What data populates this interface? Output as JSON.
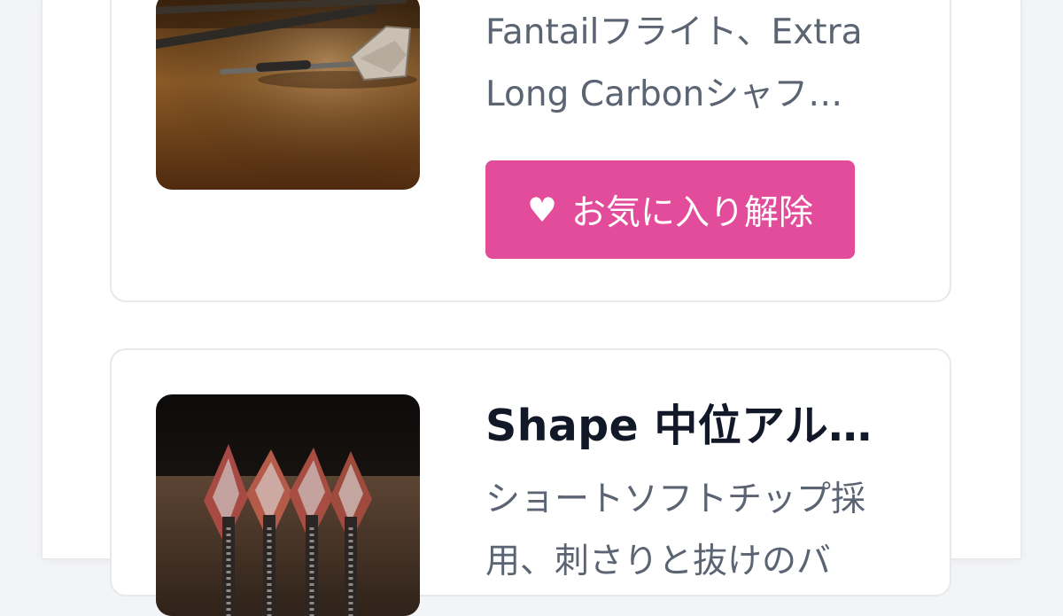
{
  "favorites": {
    "items": [
      {
        "title": "",
        "description": "Fantailフライト、Extra\nLong Carbonシャフ…",
        "unfavorite_label": "お気に入り解除",
        "image_icon": "dart-on-table-photo"
      },
      {
        "title": "Shape 中位アル…",
        "description": "ショートソフトチップ採\n用、刺さりと抜けのバ",
        "image_icon": "darts-group-photo"
      }
    ]
  },
  "colors": {
    "page_background": "#f3f4f6",
    "card_background": "#ffffff",
    "card_border": "#e7e8eb",
    "title_text": "#111827",
    "description_text": "#5b6473",
    "unfavorite_button": "#e34b9b"
  },
  "icons": {
    "heart": "heart-icon"
  }
}
